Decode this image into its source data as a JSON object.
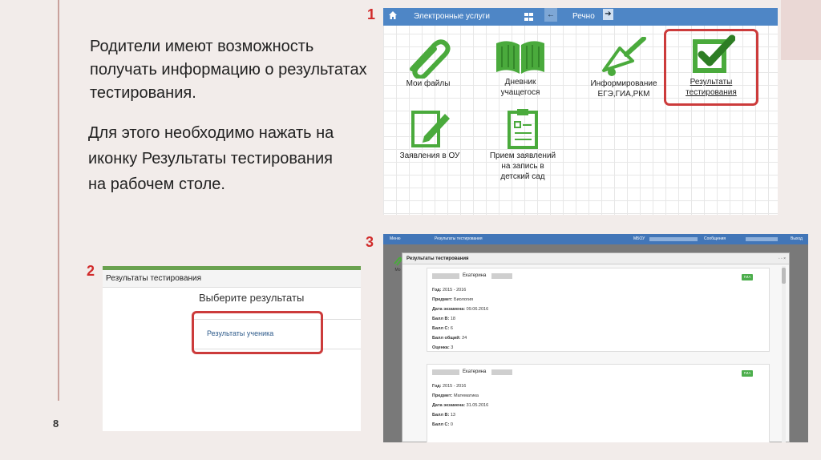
{
  "slide": {
    "main_text": "Родители имеют возможность получать информацию о результатах тестирования.",
    "sub_text": "Для этого необходимо нажать на иконку Результаты тестирования на рабочем столе.",
    "page_number": "8",
    "steps": [
      "1",
      "2",
      "3"
    ]
  },
  "screenshot1": {
    "topbar_title": "Электронные услуги",
    "tab_label": "Речно",
    "tiles": [
      {
        "label": "Мои файлы",
        "icon": "paperclip-icon"
      },
      {
        "label": "Дневник учащегося",
        "icon": "book-icon"
      },
      {
        "label": "Информирование ЕГЭ,ГИА,РКМ",
        "icon": "bell-icon"
      },
      {
        "label": "Результаты тестирования",
        "icon": "checkbox-icon"
      },
      {
        "label": "Заявления в ОУ",
        "icon": "pencil-doc-icon"
      },
      {
        "label": "Прием заявлений на запись в детский сад",
        "icon": "clipboard-icon"
      }
    ],
    "accent_color": "#4aaa3c",
    "highlight_color": "#cc3b3b"
  },
  "screenshot2": {
    "header": "Результаты тестирования",
    "prompt": "Выберите результаты",
    "link": "Результаты ученика"
  },
  "screenshot3": {
    "topbar": {
      "menu": "Меню",
      "breadcrumb": "Результаты тестирования",
      "school": "МБОУ",
      "messages": "Сообщения",
      "logout": "Выход"
    },
    "mini_icon_label": "Мо",
    "dialog_title": "Результаты тестирования",
    "records": [
      {
        "name": "Екатерина",
        "badge": "ГИА",
        "rows": [
          {
            "label": "Год:",
            "value": "2015 - 2016"
          },
          {
            "label": "Предмет:",
            "value": "Биология"
          },
          {
            "label": "Дата экзамена:",
            "value": "09.06.2016"
          },
          {
            "label": "Балл В:",
            "value": "18"
          },
          {
            "label": "Балл С:",
            "value": "6"
          },
          {
            "label": "Балл общий:",
            "value": "24"
          },
          {
            "label": "Оценка:",
            "value": "3"
          }
        ]
      },
      {
        "name": "Екатерина",
        "badge": "ГИА",
        "rows": [
          {
            "label": "Год:",
            "value": "2015 - 2016"
          },
          {
            "label": "Предмет:",
            "value": "Математика"
          },
          {
            "label": "Дата экзамена:",
            "value": "31.05.2016"
          },
          {
            "label": "Балл В:",
            "value": "13"
          },
          {
            "label": "Балл С:",
            "value": "0"
          }
        ]
      }
    ]
  }
}
